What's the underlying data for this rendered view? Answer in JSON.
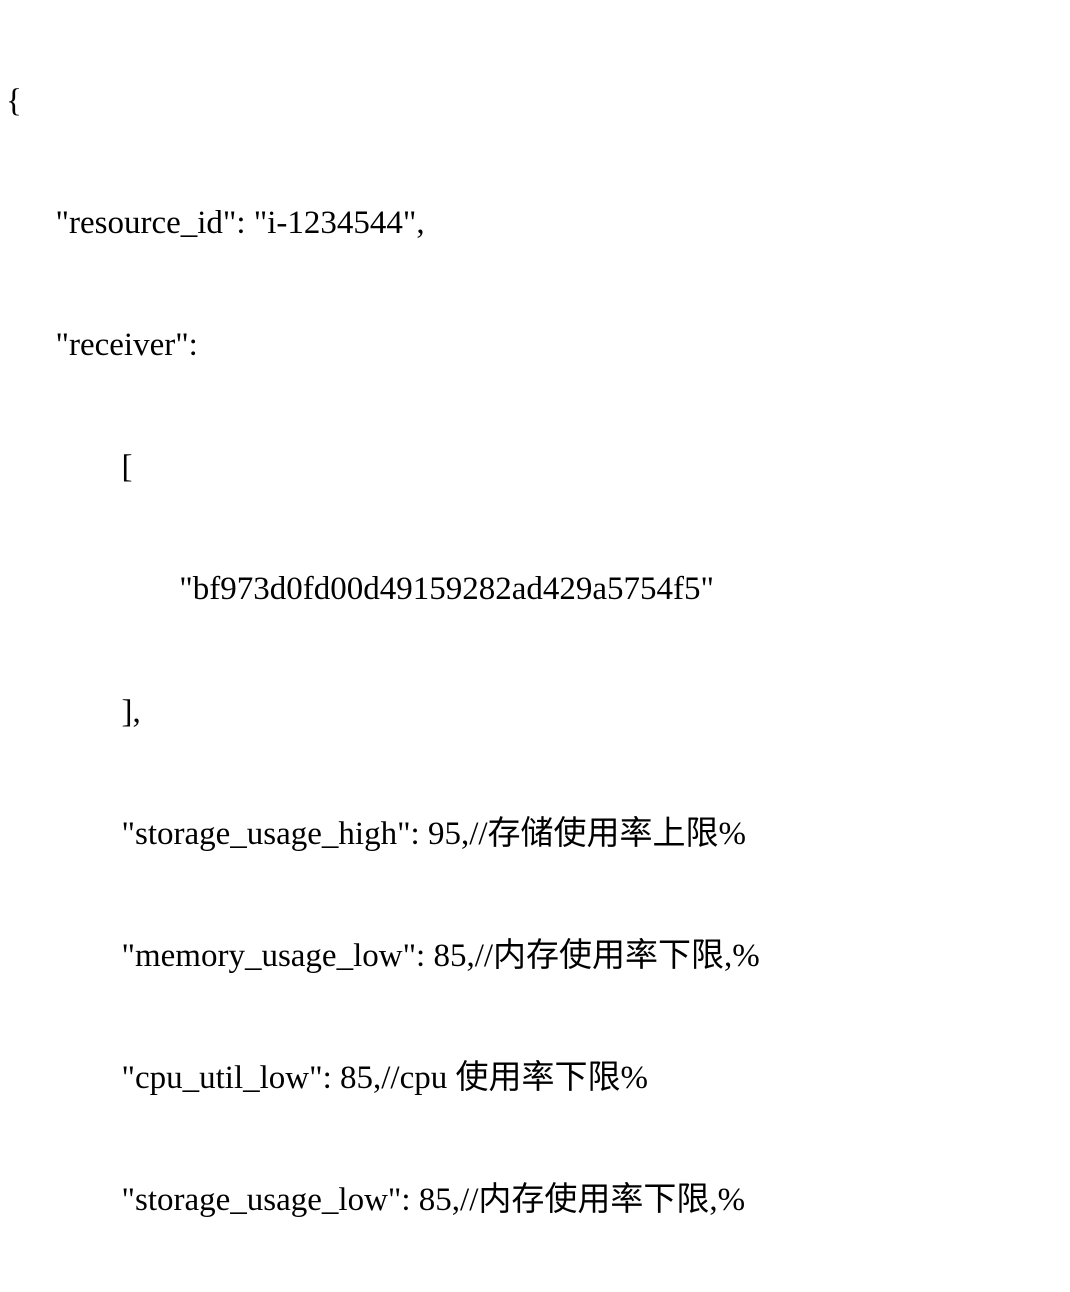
{
  "code": {
    "l0": "{",
    "l1": "      \"resource_id\": \"i-1234544\",",
    "l2": "      \"receiver\":",
    "l3": "              [",
    "l4": "                     \"bf973d0fd00d49159282ad429a5754f5\"",
    "l5": "              ],",
    "l6": "              \"storage_usage_high\": 95,//存储使用率上限%",
    "l7": "              \"memory_usage_low\": 85,//内存使用率下限,%",
    "l8": "              \"cpu_util_low\": 85,//cpu 使用率下限%",
    "l9": "              \"storage_usage_low\": 85,//内存使用率下限,%"
  }
}
